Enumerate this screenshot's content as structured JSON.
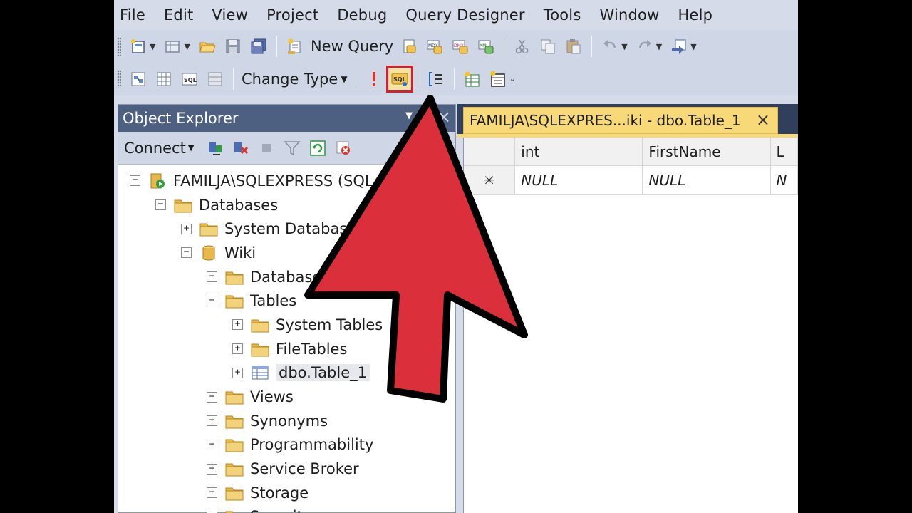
{
  "menu": [
    "File",
    "Edit",
    "View",
    "Project",
    "Debug",
    "Query Designer",
    "Tools",
    "Window",
    "Help"
  ],
  "toolbar1": {
    "new_query_label": "New Query"
  },
  "toolbar2": {
    "change_type_label": "Change Type"
  },
  "object_explorer": {
    "title": "Object Explorer",
    "connect_label": "Connect",
    "tree": [
      {
        "label": "FAMILJA\\SQLEXPRESS (SQL S",
        "expander": "−",
        "icon": "server-icon",
        "level": 0
      },
      {
        "label": "Databases",
        "expander": "−",
        "icon": "folder-icon",
        "level": 1
      },
      {
        "label": "System Databases",
        "expander": "+",
        "icon": "folder-icon",
        "level": 2
      },
      {
        "label": "Wiki",
        "expander": "−",
        "icon": "database-icon",
        "level": 2
      },
      {
        "label": "Database D",
        "expander": "+",
        "icon": "folder-icon",
        "level": 3
      },
      {
        "label": "Tables",
        "expander": "−",
        "icon": "folder-icon",
        "level": 3
      },
      {
        "label": "System Tables",
        "expander": "+",
        "icon": "folder-icon",
        "level": 4
      },
      {
        "label": "FileTables",
        "expander": "+",
        "icon": "folder-icon",
        "level": 4
      },
      {
        "label": "dbo.Table_1",
        "expander": "+",
        "icon": "table-icon",
        "level": 4,
        "selected": true
      },
      {
        "label": "Views",
        "expander": "+",
        "icon": "folder-icon",
        "level": 3
      },
      {
        "label": "Synonyms",
        "expander": "+",
        "icon": "folder-icon",
        "level": 3
      },
      {
        "label": "Programmability",
        "expander": "+",
        "icon": "folder-icon",
        "level": 3
      },
      {
        "label": "Service Broker",
        "expander": "+",
        "icon": "folder-icon",
        "level": 3
      },
      {
        "label": "Storage",
        "expander": "+",
        "icon": "folder-icon",
        "level": 3
      },
      {
        "label": "Security",
        "expander": "+",
        "icon": "folder-icon",
        "level": 3
      }
    ]
  },
  "document": {
    "tab_title": "FAMILJA\\SQLEXPRES...iki - dbo.Table_1",
    "grid": {
      "headers": [
        "int",
        "FirstName",
        "L"
      ],
      "row": {
        "marker": "✳",
        "cells": [
          "NULL",
          "NULL",
          "N"
        ]
      }
    }
  },
  "colors": {
    "arrow": "#dc2f3c",
    "highlight": "#d8202a",
    "active_tab": "#f7d978",
    "explorer_title": "#4d6082"
  }
}
